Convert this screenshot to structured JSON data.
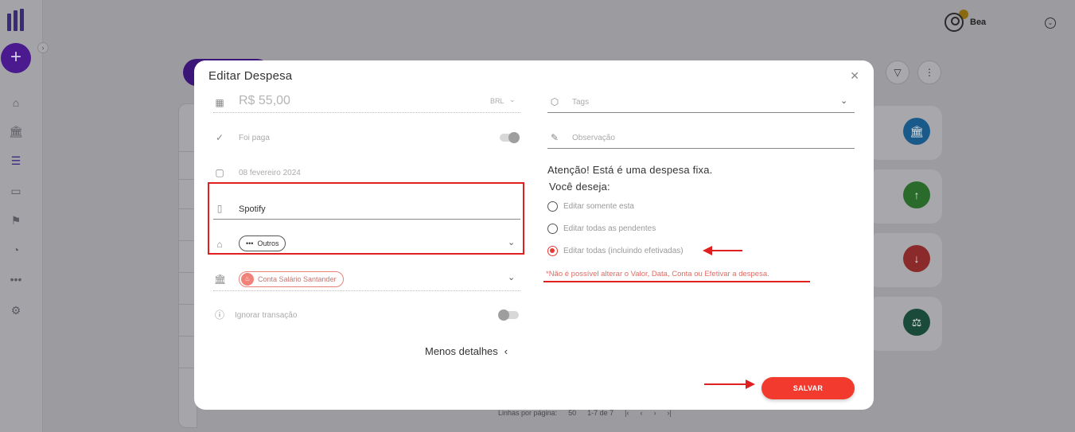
{
  "header": {
    "user_name": "Bea"
  },
  "modal": {
    "title": "Editar Despesa",
    "amount": "R$ 55,00",
    "currency": "BRL",
    "paid_label": "Foi paga",
    "date": "08 fevereiro 2024",
    "description": "Spotify",
    "category": "Outros",
    "account": "Conta Salário Santander",
    "ignore_label": "Ignorar transação",
    "less_details": "Menos detalhes",
    "tags_placeholder": "Tags",
    "observation_placeholder": "Observação",
    "warning_line1": "Atenção! Está é uma despesa fixa.",
    "warning_line2": "Você deseja:",
    "options": [
      {
        "label": "Editar somente esta",
        "checked": false
      },
      {
        "label": "Editar todas as pendentes",
        "checked": false
      },
      {
        "label": "Editar todas (incluindo efetivadas)",
        "checked": true
      }
    ],
    "note": "*Não é possível alterar o Valor, Data, Conta ou Efetivar a despesa.",
    "save_label": "SALVAR"
  },
  "pagination": {
    "rows_label": "Linhas por página:",
    "rows_value": "50",
    "range": "1-7 de 7"
  },
  "colors": {
    "accent": "#f33a2f",
    "highlight": "#e02020",
    "account_chip": "#f1827a"
  }
}
